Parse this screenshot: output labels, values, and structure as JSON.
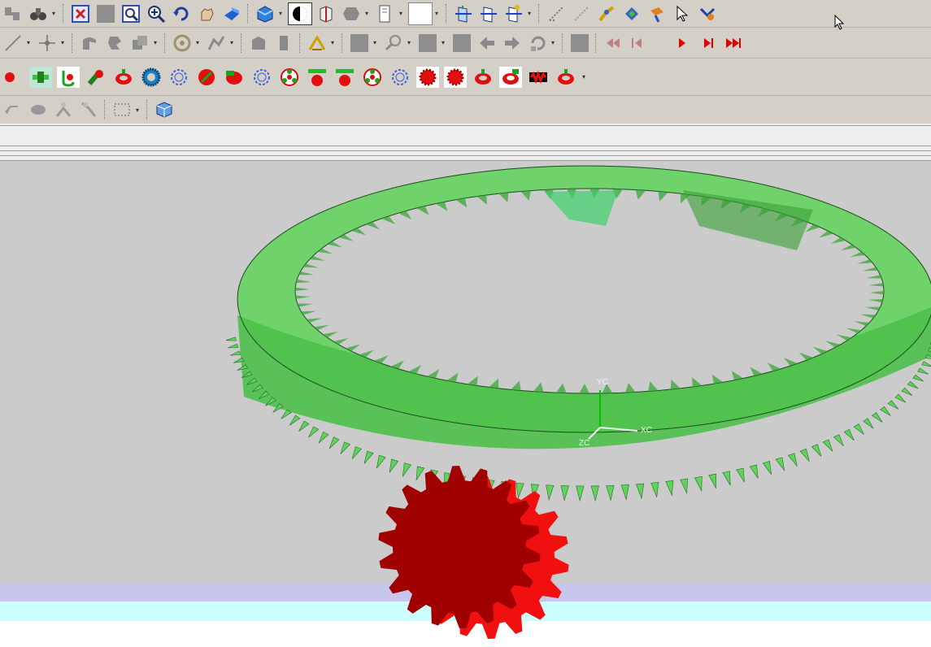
{
  "app": {
    "title": ""
  },
  "toolbar_row1": {
    "icons": [
      "part-nav-icon",
      "binoculars-icon",
      "fit-view-icon",
      "gray-square-icon",
      "zoom-window-icon",
      "zoom-in-icon",
      "rotate-icon",
      "pan-icon",
      "shaded-view-icon",
      "render-style-icon",
      "wcs-toggle-icon",
      "box-view-icon",
      "hex-view-icon",
      "drawing-sheet-icon",
      "blank-box-icon",
      "datum-plane-icon",
      "csys-plane-icon",
      "csys-dynamic-icon",
      "snap-a-icon",
      "snap-b-icon",
      "tool-a-icon",
      "tool-b-icon",
      "tool-c-icon",
      "select-arrow-icon",
      "tool-d-icon"
    ]
  },
  "toolbar_row2": {
    "icons": [
      "line-icon",
      "point-icon",
      "sweep-icon",
      "blend-icon",
      "copy-icon",
      "pattern-icon",
      "joint-icon",
      "sketch-face-icon",
      "sheet-icon",
      "arc-icon",
      "face-box-icon",
      "search-icon",
      "gray-box-a-icon",
      "gray-box-b-icon",
      "arrow-left-icon",
      "arrow-right-icon",
      "rotate-ccw-icon",
      "gray-box-c-icon"
    ],
    "playback": [
      "skip-first-icon",
      "step-back-icon",
      "play-icon",
      "step-forward-icon",
      "skip-last-icon"
    ]
  },
  "toolbar_row3": {
    "icons": [
      "gear-tool-1-icon",
      "shaft-gear-icon",
      "worm-gear-icon",
      "cylinder-gear-icon",
      "ring-gear-icon",
      "spur-blue-icon",
      "spur-outline-icon",
      "helical-gear-icon",
      "bevel-gear-icon",
      "gear-outline-b-icon",
      "planet-gear-icon",
      "rack-gear-icon",
      "rack-gear-b-icon",
      "planet-gear-b-icon",
      "gear-outline-c-icon",
      "red-gear-a-icon",
      "red-gear-b-icon",
      "ring-gear-b-icon",
      "ring-gear-c-icon",
      "gear-mesh-icon",
      "ring-gear-d-icon"
    ]
  },
  "toolbar_row4": {
    "icons": [
      "undo-icon",
      "blob-icon",
      "transform-icon",
      "transform-b-icon",
      "selection-box-icon",
      "cube-icon"
    ]
  },
  "viewport": {
    "axis": {
      "yc": "YC",
      "xc": "XC",
      "zc": "ZC"
    },
    "colors": {
      "background": "#cbcbcb",
      "ring_gear": "#5fd45b",
      "ring_gear_dark": "#3aa737",
      "pinion_front": "#a00000",
      "pinion_side": "#f01010"
    }
  }
}
